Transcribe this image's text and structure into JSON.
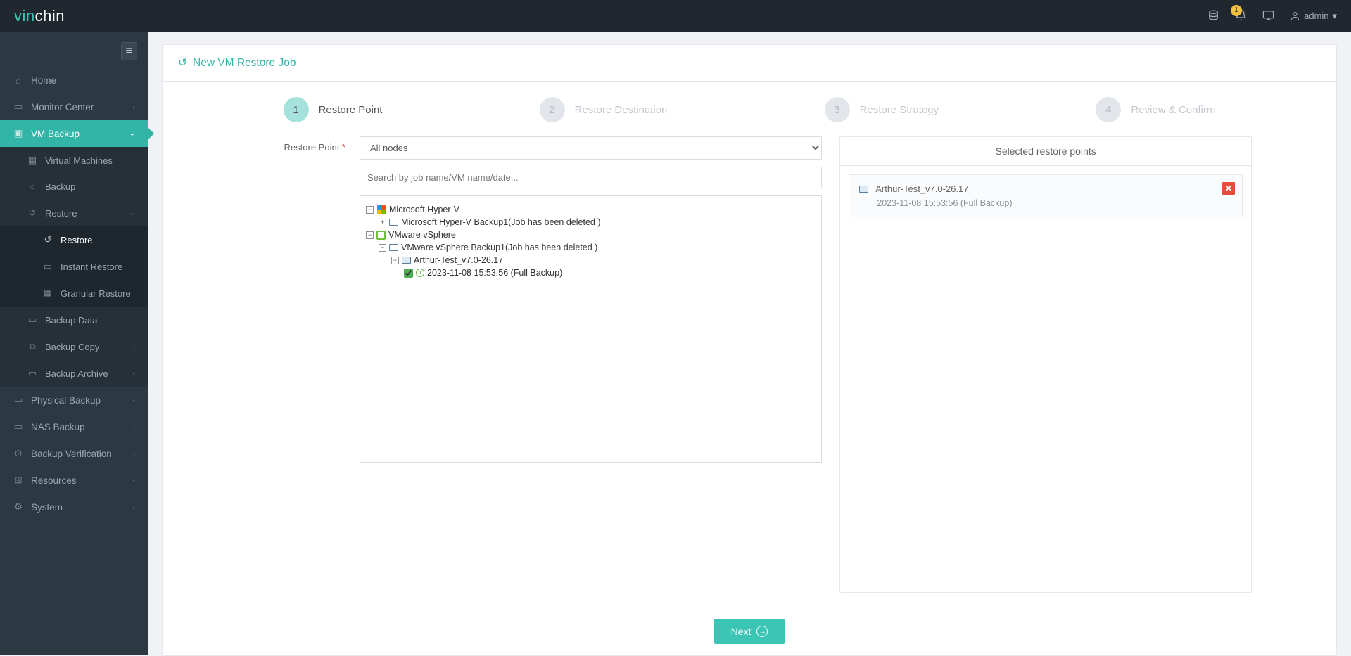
{
  "header": {
    "logo_part1": "vin",
    "logo_part2": "chin",
    "notif_count": "1",
    "user_label": "admin"
  },
  "sidebar": {
    "items": {
      "home": "Home",
      "monitor": "Monitor Center",
      "vmbackup": "VM Backup",
      "virtual_machines": "Virtual Machines",
      "backup": "Backup",
      "restore": "Restore",
      "restore_sub": "Restore",
      "instant_restore": "Instant Restore",
      "granular_restore": "Granular Restore",
      "backup_data": "Backup Data",
      "backup_copy": "Backup Copy",
      "backup_archive": "Backup Archive",
      "physical_backup": "Physical Backup",
      "nas_backup": "NAS Backup",
      "backup_verification": "Backup Verification",
      "resources": "Resources",
      "system": "System"
    }
  },
  "page": {
    "title": "New VM Restore Job",
    "steps": {
      "s1": {
        "num": "1",
        "label": "Restore Point"
      },
      "s2": {
        "num": "2",
        "label": "Restore Destination"
      },
      "s3": {
        "num": "3",
        "label": "Restore Strategy"
      },
      "s4": {
        "num": "4",
        "label": "Review & Confirm"
      }
    },
    "form_label": "Restore Point",
    "select_value": "All nodes",
    "search_placeholder": "Search by job name/VM name/date...",
    "tree": {
      "hyperv": "Microsoft Hyper-V",
      "hyperv_job": "Microsoft Hyper-V Backup1(Job has been deleted )",
      "vmware": "VMware vSphere",
      "vmware_job": "VMware vSphere Backup1(Job has been deleted )",
      "vm": "Arthur-Test_v7.0-26.17",
      "point": "2023-11-08 15:53:56 (Full  Backup)"
    },
    "selected_title": "Selected restore points",
    "sel_vm": "Arthur-Test_v7.0-26.17",
    "sel_time": "2023-11-08 15:53:56 (Full Backup)",
    "next_btn": "Next"
  }
}
